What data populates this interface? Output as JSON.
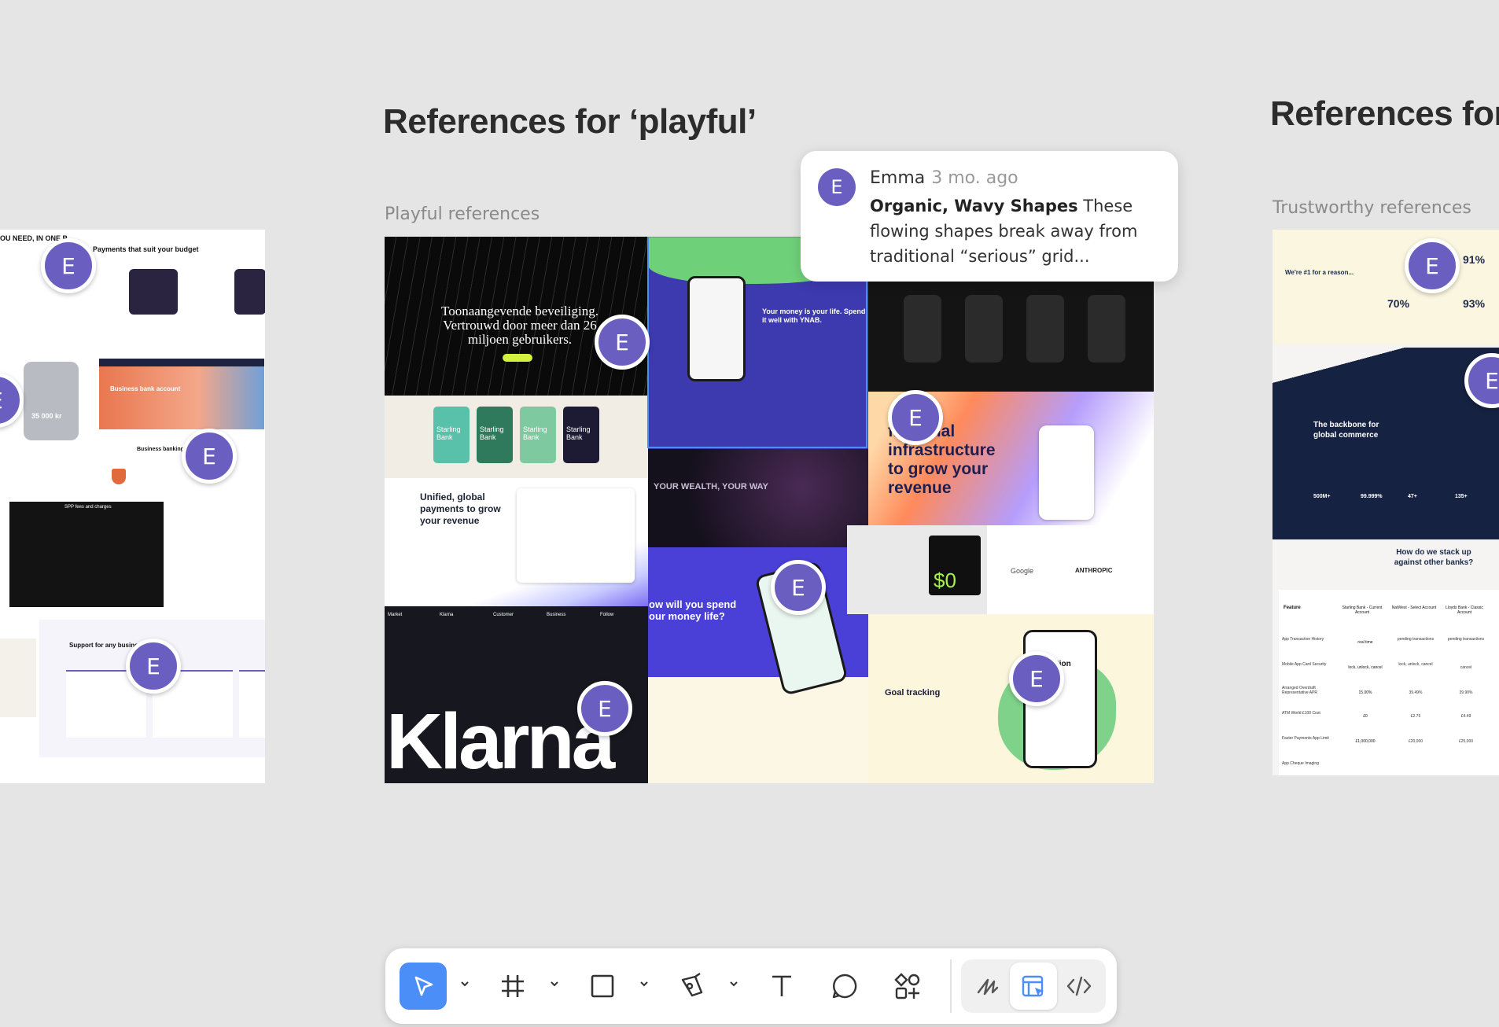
{
  "sections": {
    "left": {
      "title": ""
    },
    "playful": {
      "title": "References for ‘playful’",
      "frame_label": "Playful references"
    },
    "trustworthy": {
      "title": "References for",
      "frame_label": "Trustworthy references"
    }
  },
  "comment": {
    "avatar": "E",
    "author": "Emma",
    "time": "3 mo. ago",
    "heading": "Organic, Wavy Shapes",
    "text": "These flowing shapes break away from traditional “serious” grid..."
  },
  "avatar_initial": "E",
  "left_board": {
    "headline_1": "OU NEED, IN ONE P",
    "payments_title": "Payments that suit your budget",
    "business_bank": "Business bank account",
    "business_banking": "Business banking fo",
    "price": "35 000 kr",
    "spp_title": "SPP fees and charges",
    "support_title": "Support for any business"
  },
  "playful_board": {
    "security_text": "Toonaangevende beveiliging. Vertrouwd door meer dan 26 miljoen gebruikers.",
    "ynab_text": "Your money is your life. Spend it well with YNAB.",
    "cards": [
      "Starling Bank",
      "Starling Bank",
      "Starling Bank",
      "Starling Bank"
    ],
    "unified": "Unified, global payments to grow your revenue",
    "wealth": "YOUR WEALTH, YOUR WAY",
    "financial": "financial infrastructure to grow your revenue",
    "spend": "ow will you spend our money life?",
    "klarna": "Klarna",
    "goal": "Goal tracking",
    "vacation": "i Vacation",
    "dollar": "$0",
    "google": "Google",
    "anthropic": "ANTHROPIC",
    "footer_cols": [
      "Market",
      "Klarna",
      "Customer",
      "Business",
      "Follow"
    ]
  },
  "trust_board": {
    "reason": "We're #1 for a reason...",
    "stats": [
      "91%",
      "70%",
      "93%"
    ],
    "backbone": "The backbone for global commerce",
    "stack": "How do we stack up against other banks?",
    "figures": [
      "500M+",
      "99.999%",
      "47+",
      "135+"
    ],
    "table_head": [
      "Feature",
      "Starling Bank - Current Account",
      "NatWest - Select Account",
      "Lloyds Bank - Classic Account"
    ],
    "table_rows": [
      [
        "App Transaction History",
        "real time",
        "pending transactions",
        "pending transactions"
      ],
      [
        "Mobile App Card Security",
        "lock, unlock, cancel",
        "lock, unlock, cancel",
        "cancel"
      ],
      [
        "Arranged Overdraft Representative APR",
        "15.00%",
        "39.49%",
        "39.90%"
      ],
      [
        "ATM World £100 Cost",
        "£0",
        "£2.75",
        "£4.49"
      ],
      [
        "Faster Payments App Limit",
        "£1,000,000",
        "£20,000",
        "£25,000"
      ],
      [
        "App Cheque Imaging",
        "",
        "",
        ""
      ]
    ]
  },
  "toolbar": {
    "tools": [
      "move-tool",
      "frame-tool",
      "shape-tool",
      "pen-tool",
      "text-tool",
      "comment-tool",
      "components-tool",
      "draw-mode",
      "design-mode",
      "dev-mode"
    ],
    "active": "move-tool",
    "accent": "#4c8ef7"
  },
  "colors": {
    "canvas": "#e5e5e5",
    "avatar": "#6a5fc1",
    "selection": "#4c8ef7"
  }
}
